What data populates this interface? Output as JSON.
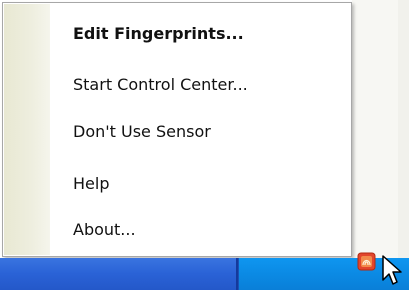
{
  "menu": {
    "items": [
      {
        "label": "Edit Fingerprints...",
        "bold": true
      },
      {
        "label": "Start Control Center...",
        "bold": false
      },
      {
        "label": "Don't Use Sensor",
        "bold": false
      },
      {
        "label": "Help",
        "bold": false
      },
      {
        "label": "About...",
        "bold": false
      }
    ]
  },
  "icons": {
    "tray": "fingerprint-sensor-icon",
    "pointer": "mouse-pointer-icon"
  },
  "colors": {
    "taskbar": "#2157c8",
    "tray": "#0b8ae4",
    "menu_gutter": "#e8e8d2",
    "tray_icon": "#e2462c"
  }
}
